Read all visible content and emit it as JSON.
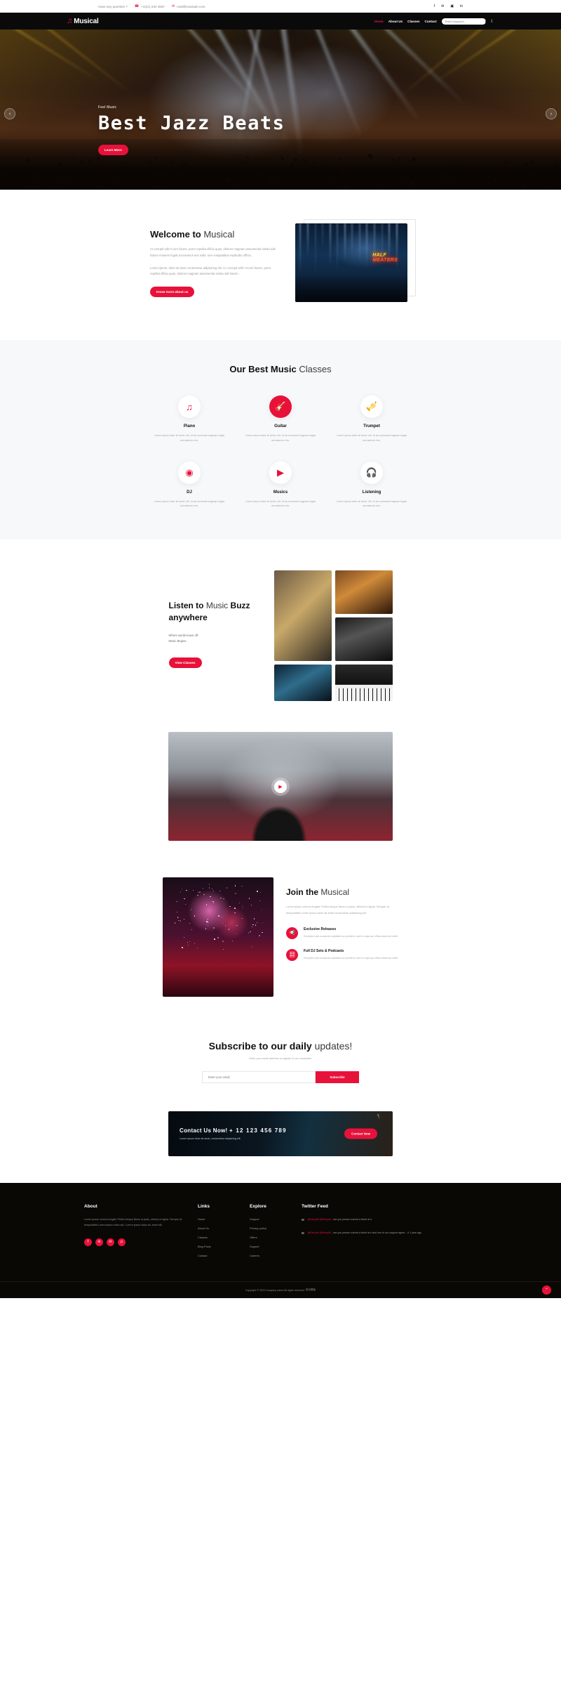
{
  "topbar": {
    "question": "Have any question ?",
    "phone": "+1(21) 234 4567",
    "email": "mail@example.com",
    "phone_icon": "phone-icon",
    "email_icon": "envelope-icon",
    "socials": [
      {
        "name": "facebook-icon",
        "glyph": "f"
      },
      {
        "name": "twitter-icon",
        "glyph": "✉"
      },
      {
        "name": "instagram-icon",
        "glyph": "▣"
      },
      {
        "name": "linkedin-icon",
        "glyph": "in"
      }
    ]
  },
  "nav": {
    "logo_mark": "♫",
    "logo_text": "Musical",
    "links": [
      {
        "label": "Home",
        "active": true
      },
      {
        "label": "About Us",
        "active": false
      },
      {
        "label": "Classes",
        "active": false
      },
      {
        "label": "Contact",
        "active": false
      }
    ],
    "search_placeholder": "Enter Keyword...",
    "search_value": "",
    "search_icon": "search-icon",
    "mode_icon": "moon-icon"
  },
  "hero": {
    "eyebrow": "Feel Music",
    "title": "Best Jazz Beats",
    "cta": "Learn More",
    "prev_icon": "chevron-left-icon",
    "next_icon": "chevron-right-icon"
  },
  "welcome": {
    "title_bold": "Welcome to",
    "title_light": "Musical",
    "p1": "At corrupti odit At iure facere, porro repellat officia quas, dolores magnam assumenda soluta odit harum maiores fugiat accusamus eos nulla. Iure voluptatibus explicabo officia.",
    "p2": "Lorem ipsum, dolor sit amet consectetur adipisicing elit. At, corrupti odit? At iure facere, porro repellat officia quas, dolores magnam assumenda soluta odit harum.",
    "cta": "Know more about us",
    "image_neon_line1": "HALF",
    "image_neon_line2": "MEATERS"
  },
  "classes": {
    "title_bold": "Our Best Music",
    "title_light": "Classes",
    "items": [
      {
        "name": "Piano",
        "icon": "music-note-icon",
        "filled": false,
        "desc": "Lorem ipsum dolor sit amet, elit. Id ab commodi magnam fugiat accusamus eos."
      },
      {
        "name": "Guitar",
        "icon": "guitar-icon",
        "filled": true,
        "desc": "Lorem ipsum dolor sit amet, elit. Id ab commodi magnam fugiat accusamus eos."
      },
      {
        "name": "Trumpet",
        "icon": "trumpet-icon",
        "filled": false,
        "desc": "Lorem ipsum dolor sit amet, elit. Id ab commodi magnam fugiat accusamus eos."
      },
      {
        "name": "DJ",
        "icon": "vinyl-record-icon",
        "filled": false,
        "desc": "Lorem ipsum dolor sit amet, elit. Id ab commodi magnam fugiat accusamus eos."
      },
      {
        "name": "Musics",
        "icon": "play-icon",
        "filled": false,
        "desc": "Lorem ipsum dolor sit amet, elit. Id ab commodi magnam fugiat accusamus eos."
      },
      {
        "name": "Listening",
        "icon": "headphones-icon",
        "filled": false,
        "desc": "Lorem ipsum dolor sit amet, elit. Id ab commodi magnam fugiat accusamus eos."
      }
    ]
  },
  "buzz": {
    "title_bold_1": "Listen to",
    "title_light": "Music",
    "title_bold_2": "Buzz anywhere",
    "sub_line1": "Where words leave off.",
    "sub_line2": "Music Begins.",
    "cta": "View Classes"
  },
  "video": {
    "play_icon": "play-icon"
  },
  "join": {
    "title_bold": "Join the",
    "title_light": "Musical",
    "lead": "Lorem ipsum viverra feugiat. Pellen tesque libero ut justo, ultrices in ligula. Semper at tempulddfel.Lorem ipsum dolor sit amet consectetur adipiscing elit.",
    "features": [
      {
        "title": "Exclusive Releases",
        "icon": "megaphone-icon",
        "desc": "Excepteur sint occaecat cupidatat non proident, sunt in culpa qui officia deserunt mollit."
      },
      {
        "title": "Full DJ Sets & Podcasts",
        "icon": "mixer-icon",
        "desc": "Excepteur sint occaecat cupidatat non proident, sunt in culpa qui officia deserunt mollit."
      }
    ]
  },
  "subscribe": {
    "title_bold": "Subscribe to our daily",
    "title_light": "updates!",
    "sub": "Enter your email address to register to our newsletter",
    "placeholder": "Enter your email",
    "value": "",
    "button": "Subscribe"
  },
  "cta_banner": {
    "heading_prefix": "Contact Us Now! ",
    "number": "+ 12  123  456  789",
    "sub": "Lorem ipsum dolor sit amet, consectetur adipiscing elit.",
    "button": "Contact Now"
  },
  "footer": {
    "about": {
      "head": "About",
      "text": "Lorem ipsum viverra feugiat. Pellen tesque libero ut justo, ultrices in ligula. Semper at tempulddfel.Lorem ipsum dolor sit,l. Lorem ipsum dolor sit, amet elit.",
      "socials": [
        {
          "name": "facebook-icon",
          "glyph": "f"
        },
        {
          "name": "linkedin-icon",
          "glyph": "in"
        },
        {
          "name": "twitter-icon",
          "glyph": "✉"
        },
        {
          "name": "pinterest-icon",
          "glyph": "p"
        }
      ]
    },
    "links": {
      "head": "Links",
      "items": [
        "Home",
        "About Us",
        "Classes",
        "Blog Posts",
        "Contact"
      ]
    },
    "explore": {
      "head": "Explore",
      "items": [
        "Support",
        "Privacy policy",
        "Offers",
        "Support",
        "Careers"
      ]
    },
    "twitter": {
      "head": "Twitter Feed",
      "tweets": [
        {
          "handle1": "@HtmyIdf",
          "handle2": "@HtmyIdf",
          "text": ", can you please submit a ticket at #"
        },
        {
          "handle1": "@HtmyIdf",
          "handle2": "@HtmyIdf",
          "text": ", can you please submit a ticket at # and one of our support agent... # 1 year ago"
        }
      ]
    },
    "copyright": "Copyright © 2023 Company name All rights reserved.",
    "credit": "网页模板",
    "scroll_top_icon": "chevron-up-icon"
  }
}
